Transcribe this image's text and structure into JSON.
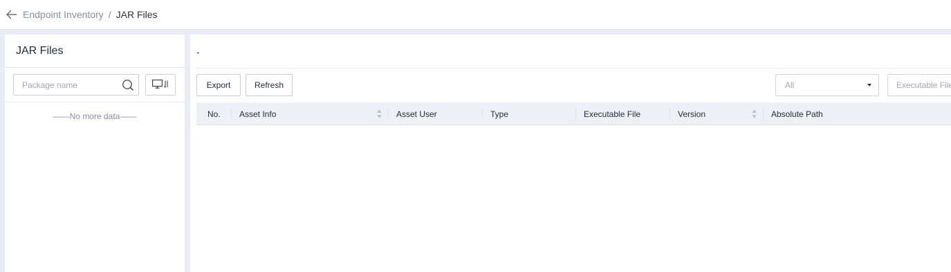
{
  "breadcrumb": {
    "parent": "Endpoint Inventory",
    "separator": "/",
    "current": "JAR Files"
  },
  "left": {
    "title": "JAR Files",
    "search_placeholder": "Package name",
    "empty_text": "——No more data——"
  },
  "main": {
    "header_text": "-",
    "export_label": "Export",
    "refresh_label": "Refresh",
    "select_value": "All",
    "filter_placeholder": "Executable File",
    "columns": [
      "No.",
      "Asset Info",
      "Asset User",
      "Type",
      "Executable File",
      "Version",
      "Absolute Path"
    ]
  },
  "icons": {
    "back": "arrow-left-icon",
    "search": "search-icon",
    "device": "monitor-icon",
    "sort": "sort-icon",
    "dropdown": "caret-down-icon"
  }
}
